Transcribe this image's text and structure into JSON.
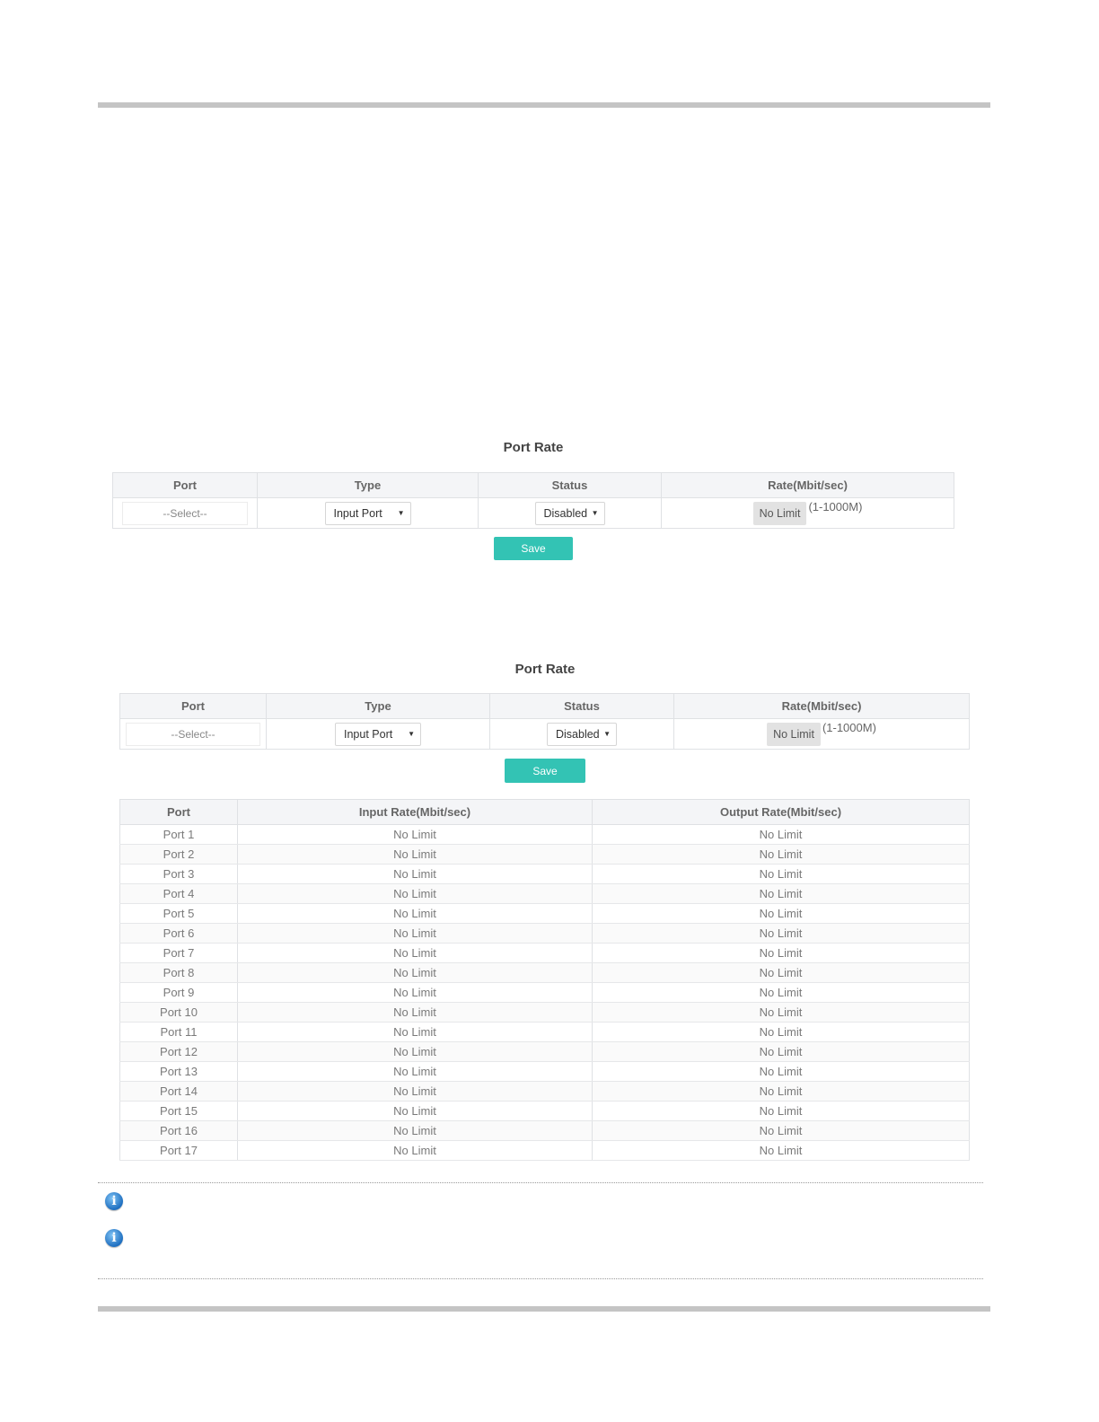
{
  "section1": {
    "title": "Port Rate",
    "headers": {
      "port": "Port",
      "type": "Type",
      "status": "Status",
      "rate": "Rate(Mbit/sec)"
    },
    "port_select": "--Select--",
    "type_value": "Input Port",
    "status_value": "Disabled",
    "rate_value": "No Limit",
    "rate_range": "(1-1000M)",
    "save_label": "Save"
  },
  "section2": {
    "title": "Port Rate",
    "headers": {
      "port": "Port",
      "type": "Type",
      "status": "Status",
      "rate": "Rate(Mbit/sec)"
    },
    "port_select": "--Select--",
    "type_value": "Input Port",
    "status_value": "Disabled",
    "rate_value": "No Limit",
    "rate_range": "(1-1000M)",
    "save_label": "Save"
  },
  "rate_table": {
    "headers": {
      "port": "Port",
      "input": "Input Rate(Mbit/sec)",
      "output": "Output Rate(Mbit/sec)"
    },
    "rows": [
      {
        "port": "Port 1",
        "input": "No Limit",
        "output": "No Limit"
      },
      {
        "port": "Port 2",
        "input": "No Limit",
        "output": "No Limit"
      },
      {
        "port": "Port 3",
        "input": "No Limit",
        "output": "No Limit"
      },
      {
        "port": "Port 4",
        "input": "No Limit",
        "output": "No Limit"
      },
      {
        "port": "Port 5",
        "input": "No Limit",
        "output": "No Limit"
      },
      {
        "port": "Port 6",
        "input": "No Limit",
        "output": "No Limit"
      },
      {
        "port": "Port 7",
        "input": "No Limit",
        "output": "No Limit"
      },
      {
        "port": "Port 8",
        "input": "No Limit",
        "output": "No Limit"
      },
      {
        "port": "Port 9",
        "input": "No Limit",
        "output": "No Limit"
      },
      {
        "port": "Port 10",
        "input": "No Limit",
        "output": "No Limit"
      },
      {
        "port": "Port 11",
        "input": "No Limit",
        "output": "No Limit"
      },
      {
        "port": "Port 12",
        "input": "No Limit",
        "output": "No Limit"
      },
      {
        "port": "Port 13",
        "input": "No Limit",
        "output": "No Limit"
      },
      {
        "port": "Port 14",
        "input": "No Limit",
        "output": "No Limit"
      },
      {
        "port": "Port 15",
        "input": "No Limit",
        "output": "No Limit"
      },
      {
        "port": "Port 16",
        "input": "No Limit",
        "output": "No Limit"
      },
      {
        "port": "Port 17",
        "input": "No Limit",
        "output": "No Limit"
      }
    ]
  },
  "icons": [
    "info-icon",
    "info-icon"
  ]
}
